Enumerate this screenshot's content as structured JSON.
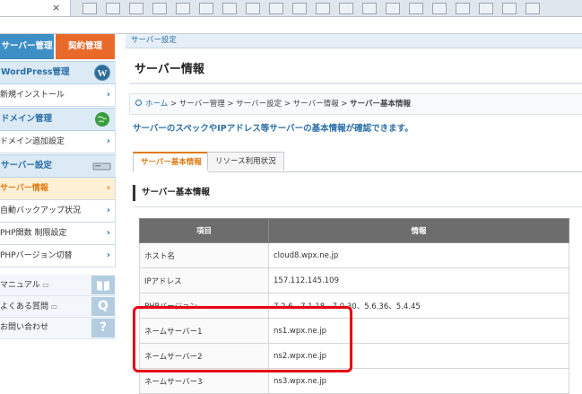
{
  "browser": {
    "tab_close": "×"
  },
  "sidebar": {
    "top_tabs": [
      {
        "label": "サーバー管理"
      },
      {
        "label": "契約管理"
      }
    ],
    "sections": [
      {
        "label": "WordPress管理",
        "icon": "wordpress-icon"
      },
      {
        "label": "ドメイン管理",
        "icon": "globe-icon"
      },
      {
        "label": "サーバー設定",
        "icon": "server-icon"
      }
    ],
    "items": [
      {
        "label": "新規インストール"
      },
      {
        "label": "ドメイン追加設定"
      },
      {
        "label": "サーバー情報",
        "active": true
      },
      {
        "label": "自動バックアップ状況"
      },
      {
        "label": "PHP関数 制限設定"
      },
      {
        "label": "PHPバージョン切替"
      }
    ],
    "chevron": "›",
    "support": [
      {
        "label": "マニュアル",
        "icon": "book-icon",
        "glyph": ""
      },
      {
        "label": "よくある質問",
        "icon": "question-icon",
        "glyph": "Q"
      },
      {
        "label": "お問い合わせ",
        "icon": "help-icon",
        "glyph": "?"
      }
    ]
  },
  "main": {
    "top_breadcrumb": "サーバー設定",
    "title": "サーバー情報",
    "breadcrumb": {
      "home": "ホーム",
      "rest": " > サーバー管理 > サーバー設定 > サーバー情報 > ",
      "current": "サーバー基本情報"
    },
    "lead": "サーバーのスペックやIPアドレス等サーバーの基本情報が確認できます。",
    "tabs": [
      {
        "label": "サーバー基本情報"
      },
      {
        "label": "リソース利用状況"
      }
    ],
    "section_title": "サーバー基本情報",
    "table": {
      "headers": [
        "項目",
        "情報"
      ],
      "rows": [
        {
          "key": "ホスト名",
          "value": "cloud8.wpx.ne.jp"
        },
        {
          "key": "IPアドレス",
          "value": "157.112.145.109"
        },
        {
          "key": "PHPバージョン",
          "value": "7.2.6、7.1.18、7.0.30、5.6.36、5.4.45"
        },
        {
          "key": "ネームサーバー1",
          "value": "ns1.wpx.ne.jp"
        },
        {
          "key": "ネームサーバー2",
          "value": "ns2.wpx.ne.jp"
        },
        {
          "key": "ネームサーバー3",
          "value": "ns3.wpx.ne.jp"
        }
      ]
    }
  },
  "colors": {
    "accent_blue": "#2b6fa8",
    "accent_orange": "#e07a13",
    "highlight_red": "#e60012"
  }
}
